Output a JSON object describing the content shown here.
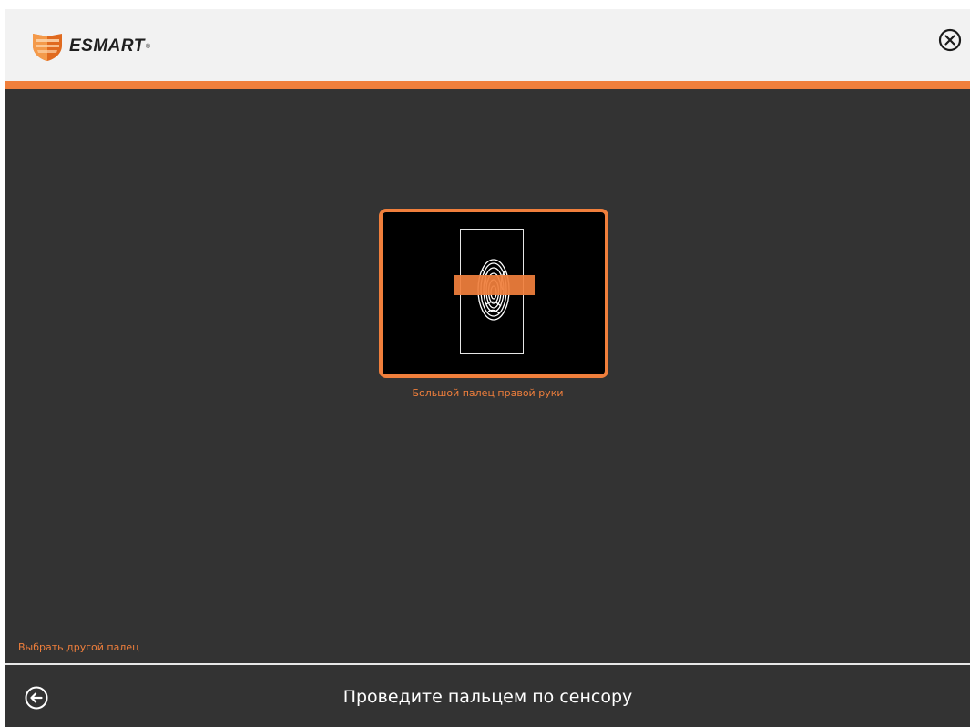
{
  "header": {
    "brand": "ESMART",
    "brand_mark": "®",
    "logo_icon": "shield-logo-icon",
    "close_icon": "close-circle-icon"
  },
  "main": {
    "finger_label": "Большой палец правой руки",
    "fingerprint_icon": "fingerprint-icon",
    "choose_other_finger": "Выбрать другой палец"
  },
  "footer": {
    "back_icon": "back-arrow-circle-icon",
    "instruction": "Проведите пальцем по сенсору"
  },
  "colors": {
    "accent": "#f07f3c",
    "background": "#333333",
    "header_bg": "#f2f2f2",
    "scan_bg": "#000000"
  }
}
